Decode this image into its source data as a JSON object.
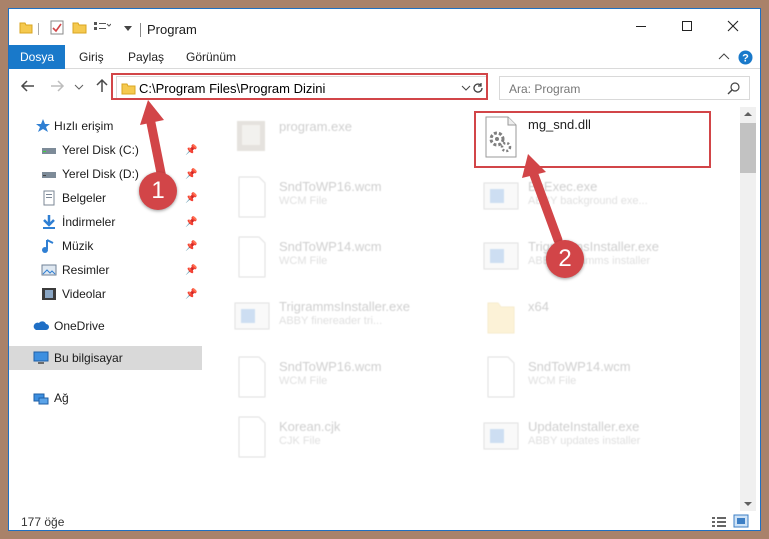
{
  "window": {
    "title": "Program",
    "controls": {
      "minimize_icon": "minimize-icon",
      "maximize_icon": "maximize-icon",
      "close_icon": "close-icon"
    }
  },
  "ribbon": {
    "file_tab": "Dosya",
    "tabs": [
      "Giriş",
      "Paylaş",
      "Görünüm"
    ]
  },
  "address": {
    "path": "C:\\Program Files\\Program Dizini",
    "search_placeholder": "Ara: Program"
  },
  "sidebar": {
    "items": [
      {
        "label": "Hızlı erişim",
        "icon": "star-icon"
      },
      {
        "label": "Yerel Disk (C:)",
        "icon": "drive-icon",
        "pinned": true
      },
      {
        "label": "Yerel Disk (D:)",
        "icon": "drive-icon",
        "pinned": true
      },
      {
        "label": "Belgeler",
        "icon": "documents-icon",
        "pinned": true
      },
      {
        "label": "İndirmeler",
        "icon": "downloads-icon",
        "pinned": true
      },
      {
        "label": "Müzik",
        "icon": "music-icon",
        "pinned": true
      },
      {
        "label": "Resimler",
        "icon": "pictures-icon",
        "pinned": true
      },
      {
        "label": "Videolar",
        "icon": "videos-icon",
        "pinned": true
      },
      {
        "label": "OneDrive",
        "icon": "cloud-icon"
      },
      {
        "label": "Bu bilgisayar",
        "icon": "computer-icon",
        "selected": true
      },
      {
        "label": "Ağ",
        "icon": "network-icon"
      }
    ]
  },
  "files": [
    {
      "name": "program.exe",
      "type": ""
    },
    {
      "name": "mg_snd.dll",
      "type": ""
    },
    {
      "name": "SndToWP16.wcm",
      "type": "WCM File"
    },
    {
      "name": "BgExec.exe",
      "type": "ABBY background exe..."
    },
    {
      "name": "SndToWP14.wcm",
      "type": "WCM File"
    },
    {
      "name": "TrigrammsInstaller.exe",
      "type": "ABBY trigramms installer"
    },
    {
      "name": "TrigrammsInstaller.exe",
      "type": "ABBY finereader tri..."
    },
    {
      "name": "x64",
      "type": ""
    },
    {
      "name": "SndToWP16.wcm",
      "type": "WCM File"
    },
    {
      "name": "SndToWP14.wcm",
      "type": "WCM File"
    },
    {
      "name": "Korean.cjk",
      "type": "CJK File"
    },
    {
      "name": "UpdateInstaller.exe",
      "type": "ABBY updates installer"
    }
  ],
  "status": {
    "count": "177 öğe"
  },
  "annotations": {
    "step1": "1",
    "step2": "2"
  },
  "colors": {
    "accent": "#1979ca",
    "annotation": "#d24548"
  }
}
